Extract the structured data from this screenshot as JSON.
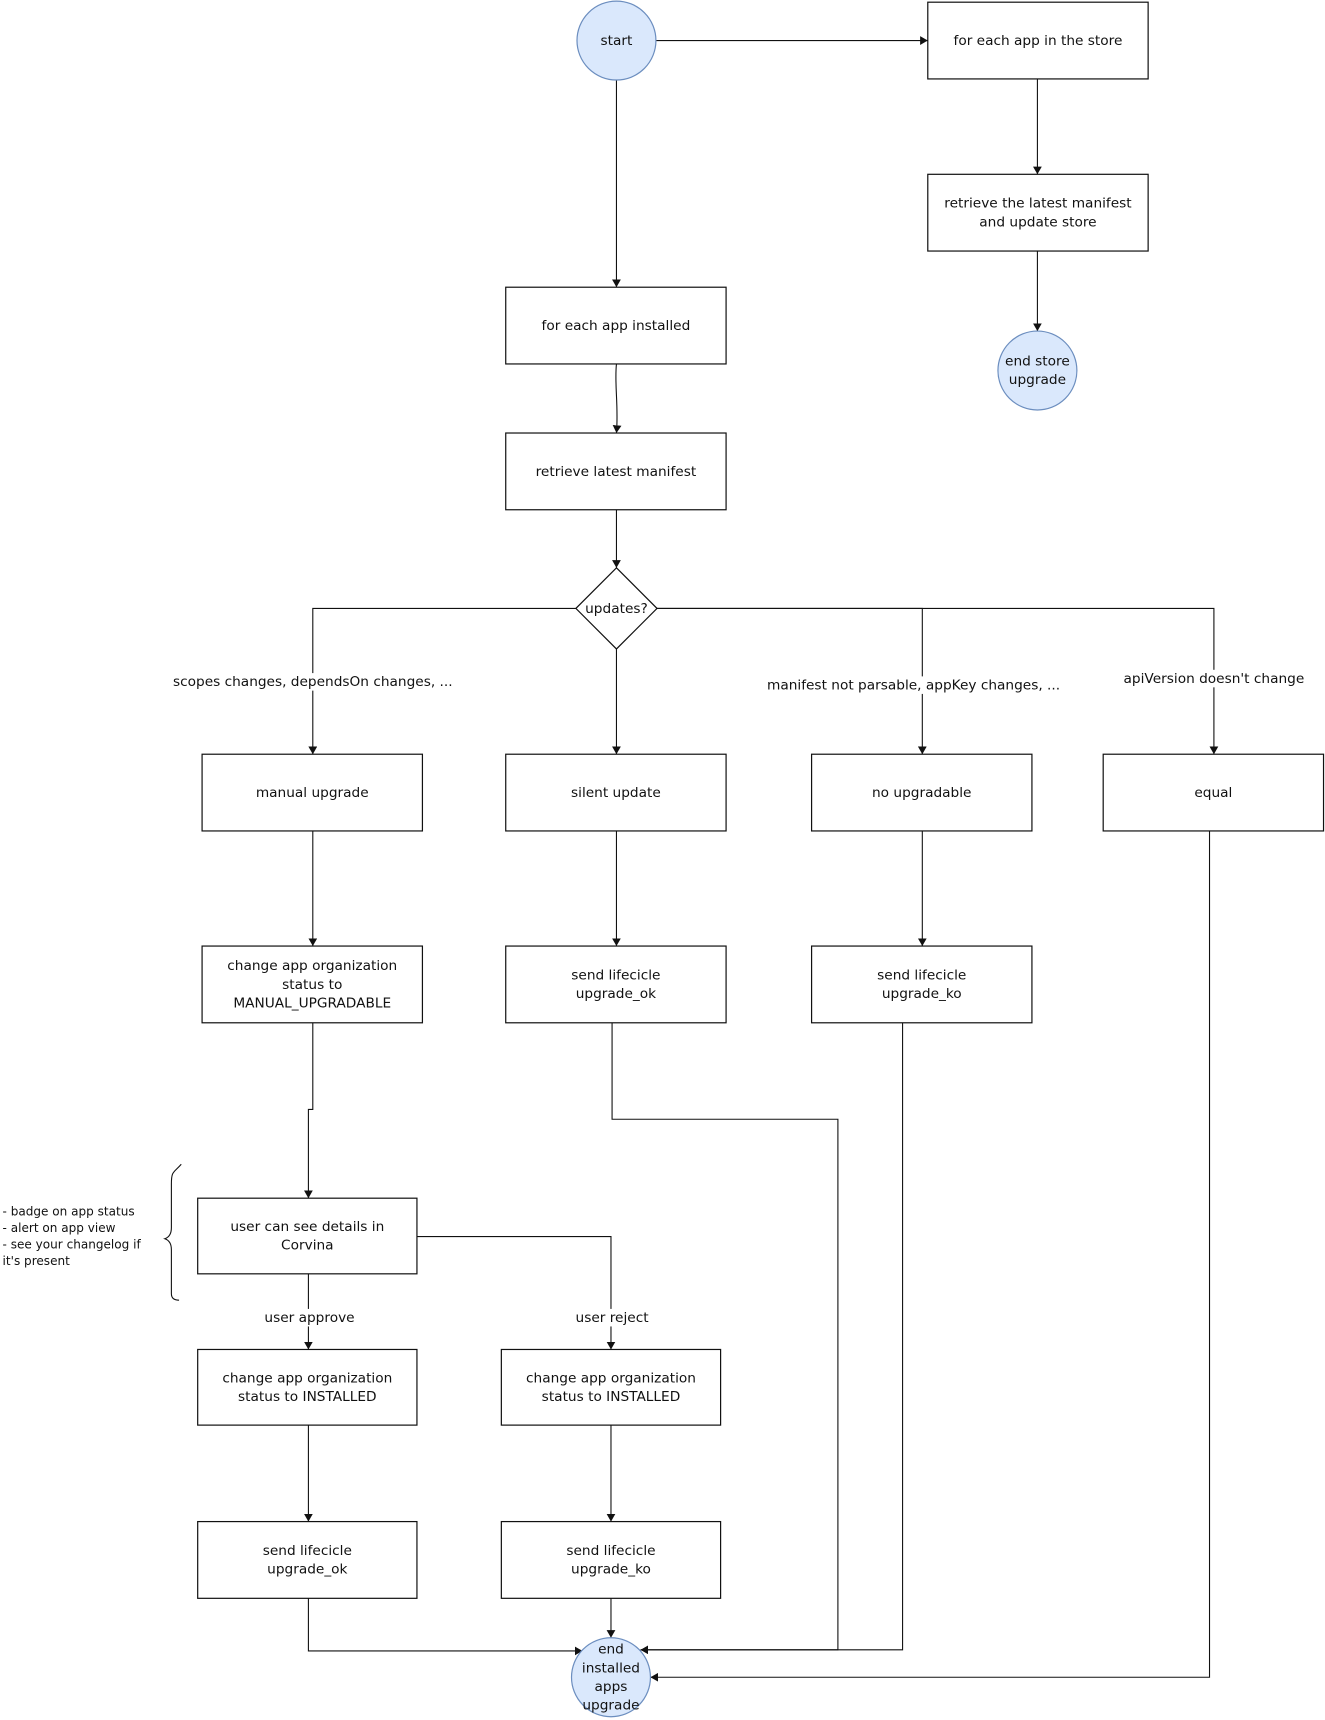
{
  "nodes": {
    "start": "start",
    "store_loop": "for each app in the store",
    "store_retrieve": [
      "retrieve the latest manifest",
      "and update store"
    ],
    "store_end": [
      "end store",
      "upgrade"
    ],
    "installed_loop": "for each app installed",
    "retrieve": "retrieve latest manifest",
    "decision": "updates?",
    "manual": "manual upgrade",
    "silent": "silent update",
    "noupg": "no upgradable",
    "equal": "equal",
    "manual_status": [
      "change app organization",
      "status to",
      "MANUAL_UPGRADABLE"
    ],
    "silent_send": [
      "send lifecicle",
      "upgrade_ok"
    ],
    "noupg_send": [
      "send lifecicle",
      "upgrade_ko"
    ],
    "user_details": [
      "user can see details in",
      "Corvina"
    ],
    "approve_status": [
      "change app organization",
      "status to INSTALLED"
    ],
    "reject_status": [
      "change app organization",
      "status to INSTALLED"
    ],
    "approve_send": [
      "send lifecicle",
      "upgrade_ok"
    ],
    "reject_send": [
      "send lifecicle",
      "upgrade_ko"
    ],
    "end": [
      "end",
      "installed",
      "apps",
      "upgrade"
    ]
  },
  "edge_labels": {
    "manual": "scopes changes, dependsOn changes, ...",
    "noupg": "manifest not parsable, appKey changes, ...",
    "equal": "apiVersion doesn't change",
    "approve": "user approve",
    "reject": "user reject"
  },
  "note": [
    "- badge on app status",
    "- alert on app view",
    "- see your changelog if",
    "it's present"
  ],
  "colors": {
    "circle_fill": "#dae8fc",
    "circle_stroke": "#6c8ebf",
    "stroke": "#111111"
  }
}
